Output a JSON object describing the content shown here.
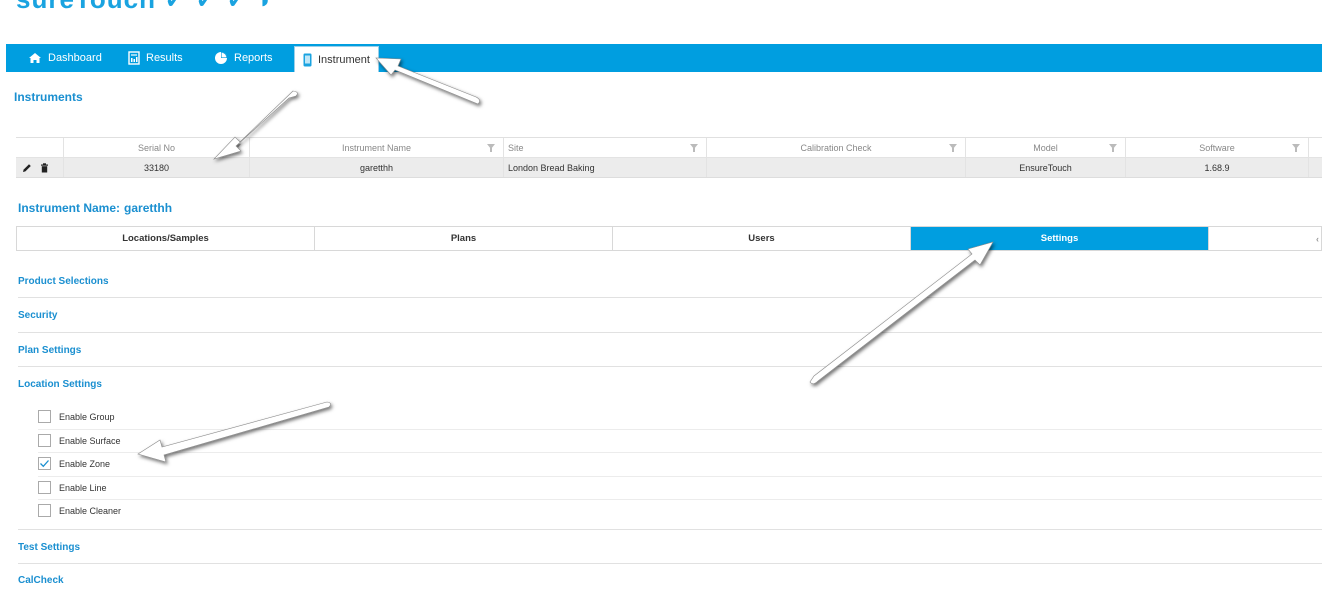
{
  "brand": {
    "logo_text": "EnsureTouch"
  },
  "nav": {
    "dashboard": "Dashboard",
    "results": "Results",
    "reports": "Reports",
    "instrument": "Instrument"
  },
  "section_title": "Instruments",
  "grid": {
    "headers": [
      "Serial No",
      "Instrument Name",
      "Site",
      "Calibration Check",
      "Model",
      "Software"
    ],
    "row": {
      "serial_no": "33180",
      "instrument_name": "garetthh",
      "site": "London Bread Baking",
      "calibration_check": "",
      "model": "EnsureTouch",
      "software": "1.68.9"
    }
  },
  "instrument_name": {
    "label": "Instrument Name:",
    "value": "garetthh"
  },
  "tabs": [
    "Locations/Samples",
    "Plans",
    "Users",
    "Settings",
    ""
  ],
  "accordion": {
    "product_selections": "Product Selections",
    "security": "Security",
    "plan_settings": "Plan Settings",
    "location_settings": "Location Settings",
    "test_settings": "Test Settings",
    "calcheck": "CalCheck"
  },
  "location_options": [
    {
      "label": "Enable Group",
      "checked": false
    },
    {
      "label": "Enable Surface",
      "checked": false
    },
    {
      "label": "Enable Zone",
      "checked": true
    },
    {
      "label": "Enable Line",
      "checked": false
    },
    {
      "label": "Enable Cleaner",
      "checked": false
    }
  ],
  "colors": {
    "accent": "#009ee0",
    "title": "#1a8fd0",
    "row_bg": "#ececec"
  }
}
